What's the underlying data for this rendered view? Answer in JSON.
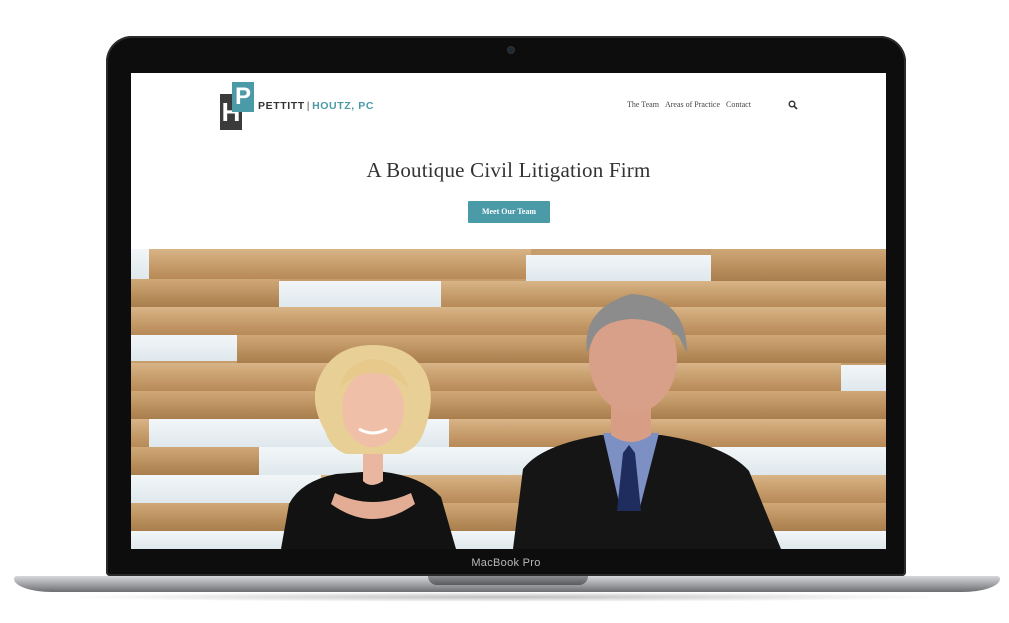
{
  "logo": {
    "name_left": "PETTITT",
    "separator": "|",
    "name_right": "HOUTZ, PC",
    "mark_letter_back": "H",
    "mark_letter_front": "P"
  },
  "nav": {
    "items": [
      {
        "label": "The Team"
      },
      {
        "label": "Areas of Practice"
      },
      {
        "label": "Contact"
      }
    ],
    "search_icon": "search-icon"
  },
  "hero": {
    "headline": "A Boutique Civil Litigation Firm",
    "cta_label": "Meet Our Team"
  },
  "device": {
    "label": "MacBook Pro"
  },
  "colors": {
    "accent": "#4a9aa8",
    "text_dark": "#333333",
    "logo_dark": "#3b3b3b"
  }
}
